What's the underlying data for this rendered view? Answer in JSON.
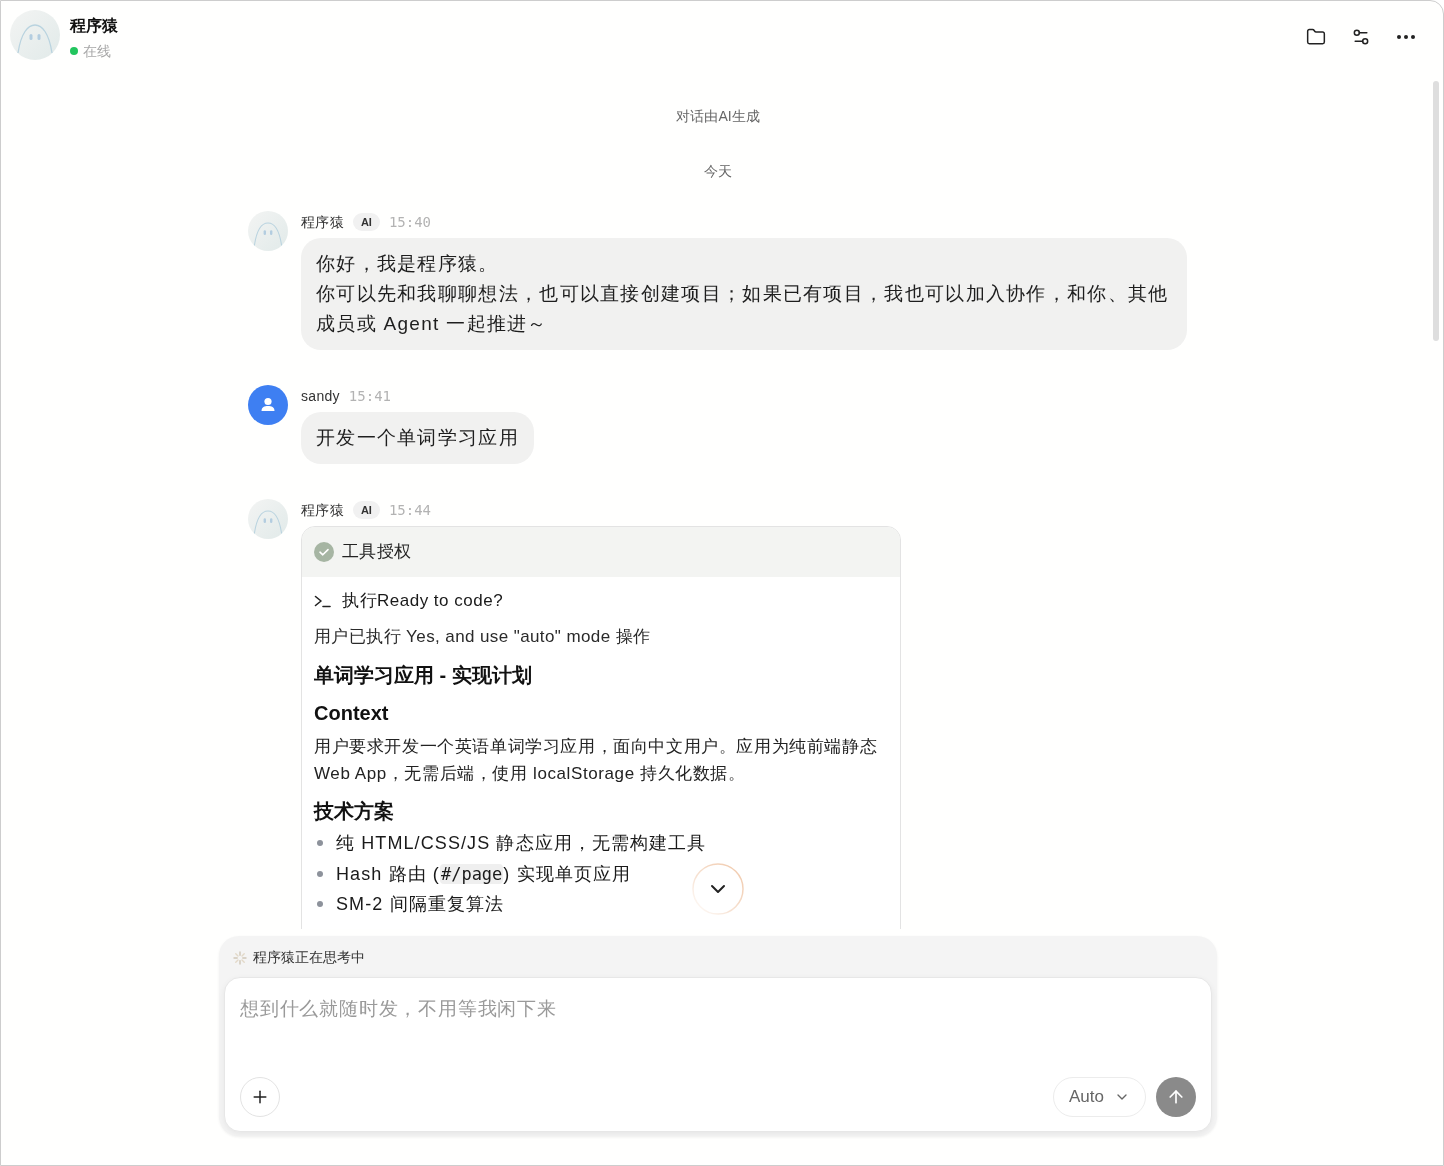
{
  "header": {
    "name": "程序猿",
    "status": "在线",
    "online": true
  },
  "notice": "对话由AI生成",
  "date_divider": "今天",
  "messages": [
    {
      "avatar": {
        "kind": "bot"
      },
      "sender": "程序猿",
      "badge": "AI",
      "time": "15:40",
      "kind": "text",
      "lines": [
        "你好，我是程序猿。",
        "你可以先和我聊聊想法，也可以直接创建项目；如果已有项目，我也可以加入协作，和你、其他成员或 Agent 一起推进～"
      ]
    },
    {
      "avatar": {
        "kind": "user"
      },
      "sender": "sandy",
      "time": "15:41",
      "kind": "text",
      "lines": [
        "开发一个单词学习应用"
      ]
    },
    {
      "avatar": {
        "kind": "bot"
      },
      "sender": "程序猿",
      "badge": "AI",
      "time": "15:44",
      "kind": "tool_card",
      "card": {
        "title": "工具授权",
        "approved": true,
        "command": "执行Ready to code?",
        "result": "用户已执行 Yes, and use \"auto\" mode 操作",
        "blocks": [
          {
            "kind": "title",
            "text": "单词学习应用 - 实现计划"
          },
          {
            "kind": "heading",
            "text": "Context"
          },
          {
            "kind": "paragraph",
            "text": "用户要求开发一个英语单词学习应用，面向中文用户。应用为纯前端静态 Web App，无需后端，使用 localStorage 持久化数据。"
          },
          {
            "kind": "heading",
            "text": "技术方案"
          },
          {
            "kind": "list",
            "items": [
              {
                "segments": [
                  {
                    "text": "纯 HTML/CSS/JS 静态应用，无需构建工具",
                    "code": false
                  }
                ]
              },
              {
                "segments": [
                  {
                    "text": "Hash 路由 (",
                    "code": false
                  },
                  {
                    "text": "#/page",
                    "code": true
                  },
                  {
                    "text": ") 实现单页应用",
                    "code": false
                  }
                ]
              },
              {
                "segments": [
                  {
                    "text": "SM-2 间隔重复算法",
                    "code": false
                  }
                ]
              }
            ]
          }
        ]
      }
    }
  ],
  "composer": {
    "status": "程序猿正在思考中",
    "placeholder": "想到什么就随时发，不用等我闲下来",
    "mode": "Auto"
  }
}
